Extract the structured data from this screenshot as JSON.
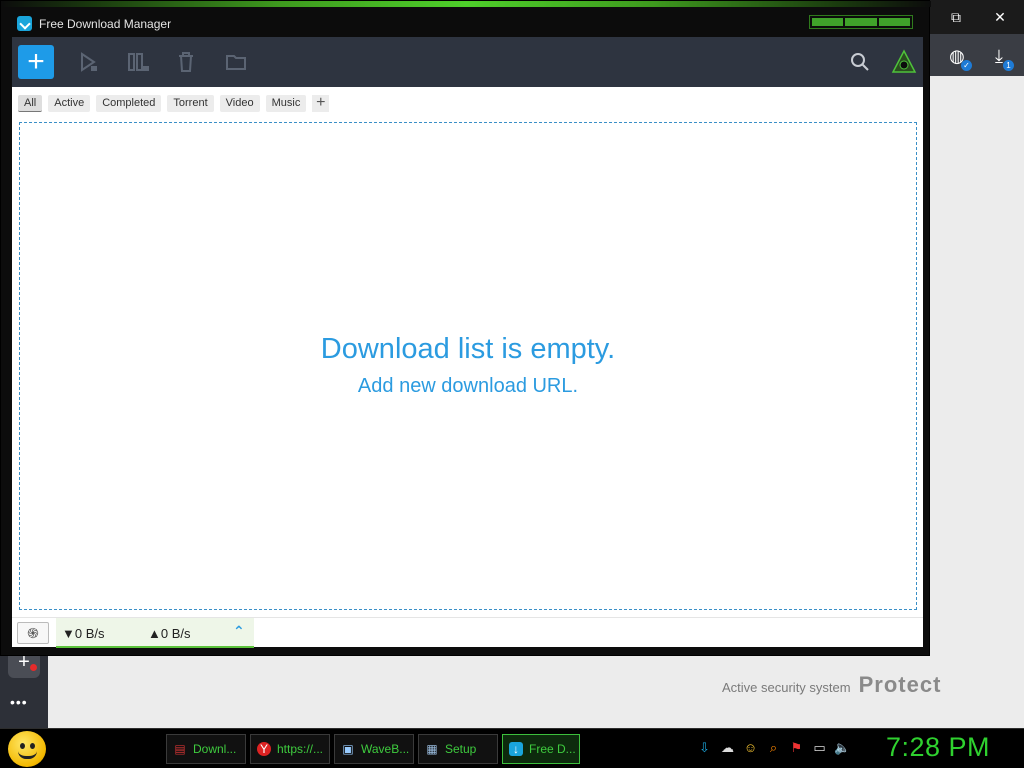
{
  "window": {
    "title": "Free Download Manager"
  },
  "tabs": [
    "All",
    "Active",
    "Completed",
    "Torrent",
    "Video",
    "Music"
  ],
  "tab_add_label": "+",
  "toolbar": {
    "add_label": "+"
  },
  "empty": {
    "title": "Download list is empty.",
    "subtitle": "Add new download URL."
  },
  "status": {
    "download_speed": "▼0 B/s",
    "upload_speed": "▲0 B/s"
  },
  "background": {
    "protect_caption": "Active security system",
    "protect_brand": "Protect",
    "download_badge": "1"
  },
  "taskbar": {
    "items": [
      {
        "label": "Downl...",
        "icon": "doc-icon"
      },
      {
        "label": "https://...",
        "icon": "yandex-icon"
      },
      {
        "label": "WaveB...",
        "icon": "app-icon"
      },
      {
        "label": "Setup",
        "icon": "setup-icon"
      },
      {
        "label": "Free D...",
        "icon": "fdm-icon"
      }
    ],
    "clock": "7:28 PM"
  },
  "colors": {
    "accent": "#2b9be0",
    "taskbar_text": "#3ecb3e",
    "toolbar": "#2e3440"
  }
}
